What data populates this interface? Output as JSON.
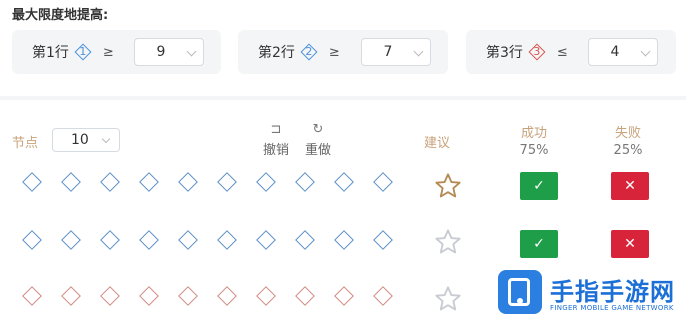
{
  "title": "最大限度地提高:",
  "constraints": [
    {
      "label": "第1行",
      "badge": "1",
      "badge_color": "#4a90d9",
      "operator": "≥",
      "value": "9"
    },
    {
      "label": "第2行",
      "badge": "2",
      "badge_color": "#4a90d9",
      "operator": "≥",
      "value": "7"
    },
    {
      "label": "第3行",
      "badge": "3",
      "badge_color": "#d9534f",
      "operator": "≤",
      "value": "4"
    }
  ],
  "controls": {
    "nodes_label": "节点",
    "nodes_value": "10",
    "undo_label": "撤销",
    "redo_label": "重做",
    "undo_icon": "undo-icon",
    "redo_icon": "redo-icon",
    "suggest_label": "建议",
    "success_label": "成功",
    "success_pct": "75%",
    "fail_label": "失败",
    "fail_pct": "25%"
  },
  "rows": [
    {
      "color": "#5b8fc9",
      "star": "outline-gold",
      "success_icon": "check",
      "fail_icon": "cross"
    },
    {
      "color": "#5b8fc9",
      "star": "outline-grey",
      "success_icon": "check",
      "fail_icon": "cross"
    },
    {
      "color": "#d08a82",
      "star": "outline-grey"
    }
  ],
  "colors": {
    "success": "#1e9e48",
    "fail": "#d7243a",
    "header": "#c8a27a",
    "star_gold": "#b58a55",
    "star_grey": "#c8ccd2"
  },
  "buttons": {
    "ok_glyph": "✓",
    "x_glyph": "✕"
  },
  "watermark": {
    "name": "手指手游网",
    "sub": "FINGER MOBILE GAME NETWORK"
  }
}
